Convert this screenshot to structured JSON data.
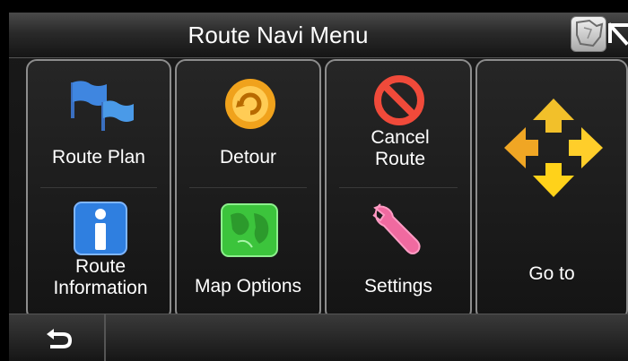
{
  "title": "Route Navi Menu",
  "menu": {
    "route_plan": "Route Plan",
    "detour": "Detour",
    "cancel_route": "Cancel Route",
    "route_information": "Route Information",
    "map_options": "Map Options",
    "settings": "Settings",
    "go_to": "Go to"
  },
  "icons": {
    "map": "map-thumbnail-icon",
    "back_arrow": "back-arrow-icon",
    "return": "return-icon"
  }
}
